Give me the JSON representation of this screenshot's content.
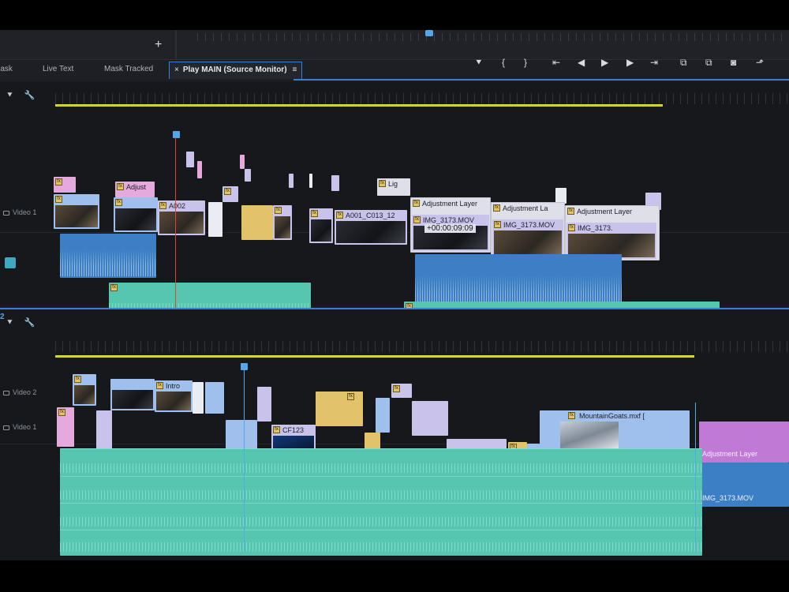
{
  "top": {
    "add_label": "+"
  },
  "tabs": [
    {
      "label": "Mask",
      "active": false
    },
    {
      "label": "Live Text",
      "active": false
    },
    {
      "label": "Mask Tracked",
      "active": false
    },
    {
      "label": "Play MAIN (Source Monitor)",
      "active": true,
      "close": "×",
      "menu": "≡"
    }
  ],
  "transport": [
    {
      "icon": "marker-icon",
      "glyph": "⯆"
    },
    {
      "icon": "mark-in-icon",
      "glyph": "{"
    },
    {
      "icon": "mark-out-icon",
      "glyph": "}"
    },
    {
      "icon": "go-to-in-icon",
      "glyph": "⇤"
    },
    {
      "icon": "step-back-icon",
      "glyph": "◀"
    },
    {
      "icon": "play-icon",
      "glyph": "▶"
    },
    {
      "icon": "step-forward-icon",
      "glyph": "▶"
    },
    {
      "icon": "go-to-out-icon",
      "glyph": "⇥"
    },
    {
      "icon": "insert-icon",
      "glyph": "⧉"
    },
    {
      "icon": "overwrite-icon",
      "glyph": "⧉"
    },
    {
      "icon": "export-frame-icon",
      "glyph": "◙"
    },
    {
      "icon": "button-editor-icon",
      "glyph": "⬏"
    }
  ],
  "panel1": {
    "index": "",
    "tools": {
      "marker": "⯆",
      "wrench": "🔧"
    },
    "tracks": [
      "Video 1"
    ],
    "clips": {
      "adjust_label": "Adjust",
      "a002": "A002",
      "a001": "A001_C013_12",
      "lig": "Lig",
      "adj1": "Adjustment Layer",
      "adj2": "Adjustment La",
      "adj3": "Adjustment Layer",
      "img1": "IMG_3173.MOV",
      "img2": "IMG_3173.MOV",
      "img3": "IMG_3173.",
      "timecode": "+00:00:09:09"
    }
  },
  "panel2": {
    "index": "2",
    "tracks": [
      "Video 2",
      "Video 1"
    ],
    "clips": {
      "intro": "Intro",
      "cf": "CF123",
      "mountain": "MountainGoats.mxf [",
      "adj": "Adjustment Layer",
      "img": "IMG_3173.MOV"
    }
  },
  "colors": {
    "accent": "#3b7fd0",
    "playhead_blue": "#52a8e8",
    "playhead_red": "#e0442a",
    "work_area": "#d8d23a"
  }
}
